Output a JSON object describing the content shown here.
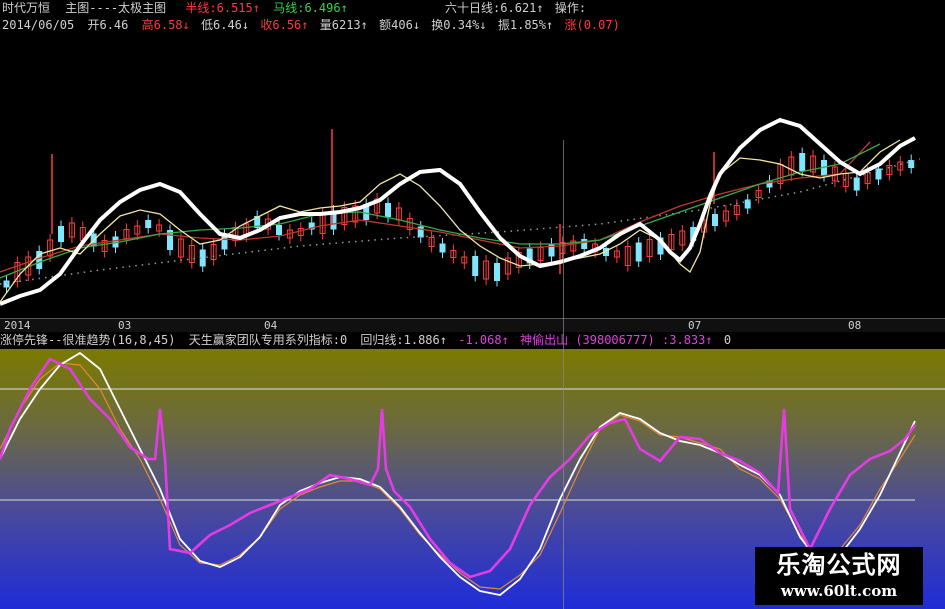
{
  "header": {
    "app_name": "时代万恒",
    "main_chart": "主图----太极主图",
    "ma_half_year": "半线:6.515",
    "ma_horse": "马线:6.496",
    "ma_sixty": "六十日线:6.621",
    "operation": "操作:"
  },
  "quote": {
    "date": "2014/06/05",
    "open": "开6.46",
    "high": "高6.58",
    "low": "低6.46",
    "close": "收6.56",
    "volume": "量6213",
    "amount": "额406",
    "turnover": "换0.34%",
    "amplitude": "振1.85%",
    "change": "涨(0.07)"
  },
  "axis": {
    "labels": [
      "2014",
      "03",
      "04",
      "07",
      "08"
    ]
  },
  "indicator": {
    "name": "涨停先锋--很准趋势(16,8,45)",
    "desc": "天生赢家团队专用系列指标:0",
    "regress": "回归线:1.886",
    "neg": "-1.068",
    "shentou": "神偷出山",
    "shentou_val": "(398006777)",
    "shentou_num": ":3.833",
    "zero": "0"
  },
  "watermark": {
    "name": "乐淘公式网",
    "url": "www.60lt.com"
  },
  "colors": {
    "red": "#ff3b3b",
    "green": "#39d14a",
    "yellow": "#f0e000",
    "magenta": "#e43ce4",
    "white": "#ffffff",
    "cyan": "#7fe6ff"
  }
}
